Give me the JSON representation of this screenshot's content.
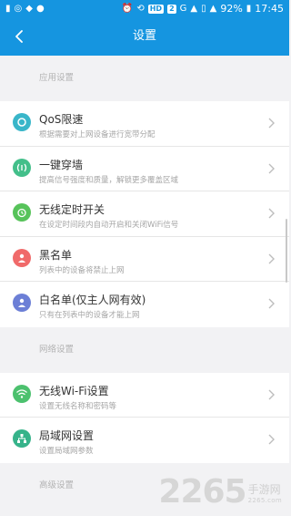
{
  "status_bar": {
    "hd_badge": "HD",
    "sim_badge": "2",
    "network": "G",
    "battery": "92%",
    "time": "17:45"
  },
  "header": {
    "title": "设置",
    "back_icon": "back-arrow-icon"
  },
  "sections": [
    {
      "label": "应用设置",
      "items": [
        {
          "title": "QoS限速",
          "subtitle": "根据需要对上网设备进行宽带分配",
          "icon": "qos-speed-icon",
          "color": "#39b6c9"
        },
        {
          "title": "一键穿墙",
          "subtitle": "提高信号强度和质量，解锁更多覆盖区域",
          "icon": "signal-boost-icon",
          "color": "#43bf8a"
        },
        {
          "title": "无线定时开关",
          "subtitle": "在设定时间段内自动开启和关闭WiFi信号",
          "icon": "alarm-clock-icon",
          "color": "#57c35a"
        },
        {
          "title": "黑名单",
          "subtitle": "列表中的设备将禁止上网",
          "icon": "user-block-icon",
          "color": "#f06a6a"
        },
        {
          "title": "白名单(仅主人网有效)",
          "subtitle": "只有在列表中的设备才能上网",
          "icon": "user-allow-icon",
          "color": "#6c7fd6"
        }
      ]
    },
    {
      "label": "网络设置",
      "items": [
        {
          "title": "无线Wi-Fi设置",
          "subtitle": "设置无线名称和密码等",
          "icon": "wifi-icon",
          "color": "#4cc16e"
        },
        {
          "title": "局域网设置",
          "subtitle": "设置局域网参数",
          "icon": "lan-icon",
          "color": "#36b38a"
        }
      ]
    },
    {
      "label": "高级设置",
      "items": []
    }
  ],
  "watermark": {
    "number": "2265",
    "cn": "手游网",
    "en": "2265.com"
  }
}
